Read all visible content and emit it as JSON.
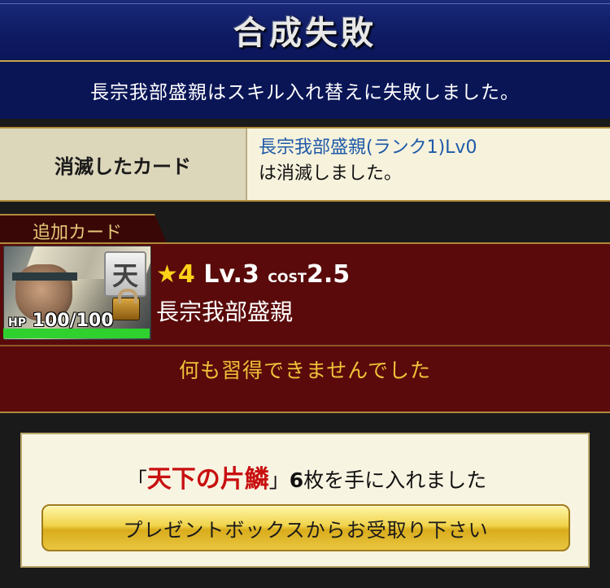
{
  "header": {
    "title": "合成失敗",
    "message": "長宗我部盛親はスキル入れ替えに失敗しました。"
  },
  "destroyed": {
    "label": "消滅したカード",
    "card_name": "長宗我部盛親(ランク1)Lv0",
    "suffix": "は消滅しました。"
  },
  "added": {
    "tab_label": "追加カード",
    "card": {
      "rarity_icon": "天",
      "star": "★4",
      "level": "Lv.3",
      "cost_label": "COST",
      "cost_value": "2.5",
      "name": "長宗我部盛親",
      "hp_label": "HP",
      "hp_value": "100/100",
      "hp_fraction": 1.0
    },
    "result": "何も習得できませんでした"
  },
  "reward": {
    "open_quote": "「",
    "item_name": "天下の片鱗",
    "close_quote": "」",
    "count": "6",
    "suffix": "枚を手に入れました",
    "button_label": "プレゼントボックスからお受取り下さい"
  },
  "colors": {
    "header_bg": "#0e1a62",
    "gold_border": "#b08a3a",
    "panel_red": "#5a0a0a",
    "link_blue": "#1e5aa8",
    "item_red": "#c81010",
    "result_yellow": "#f0c23a"
  }
}
